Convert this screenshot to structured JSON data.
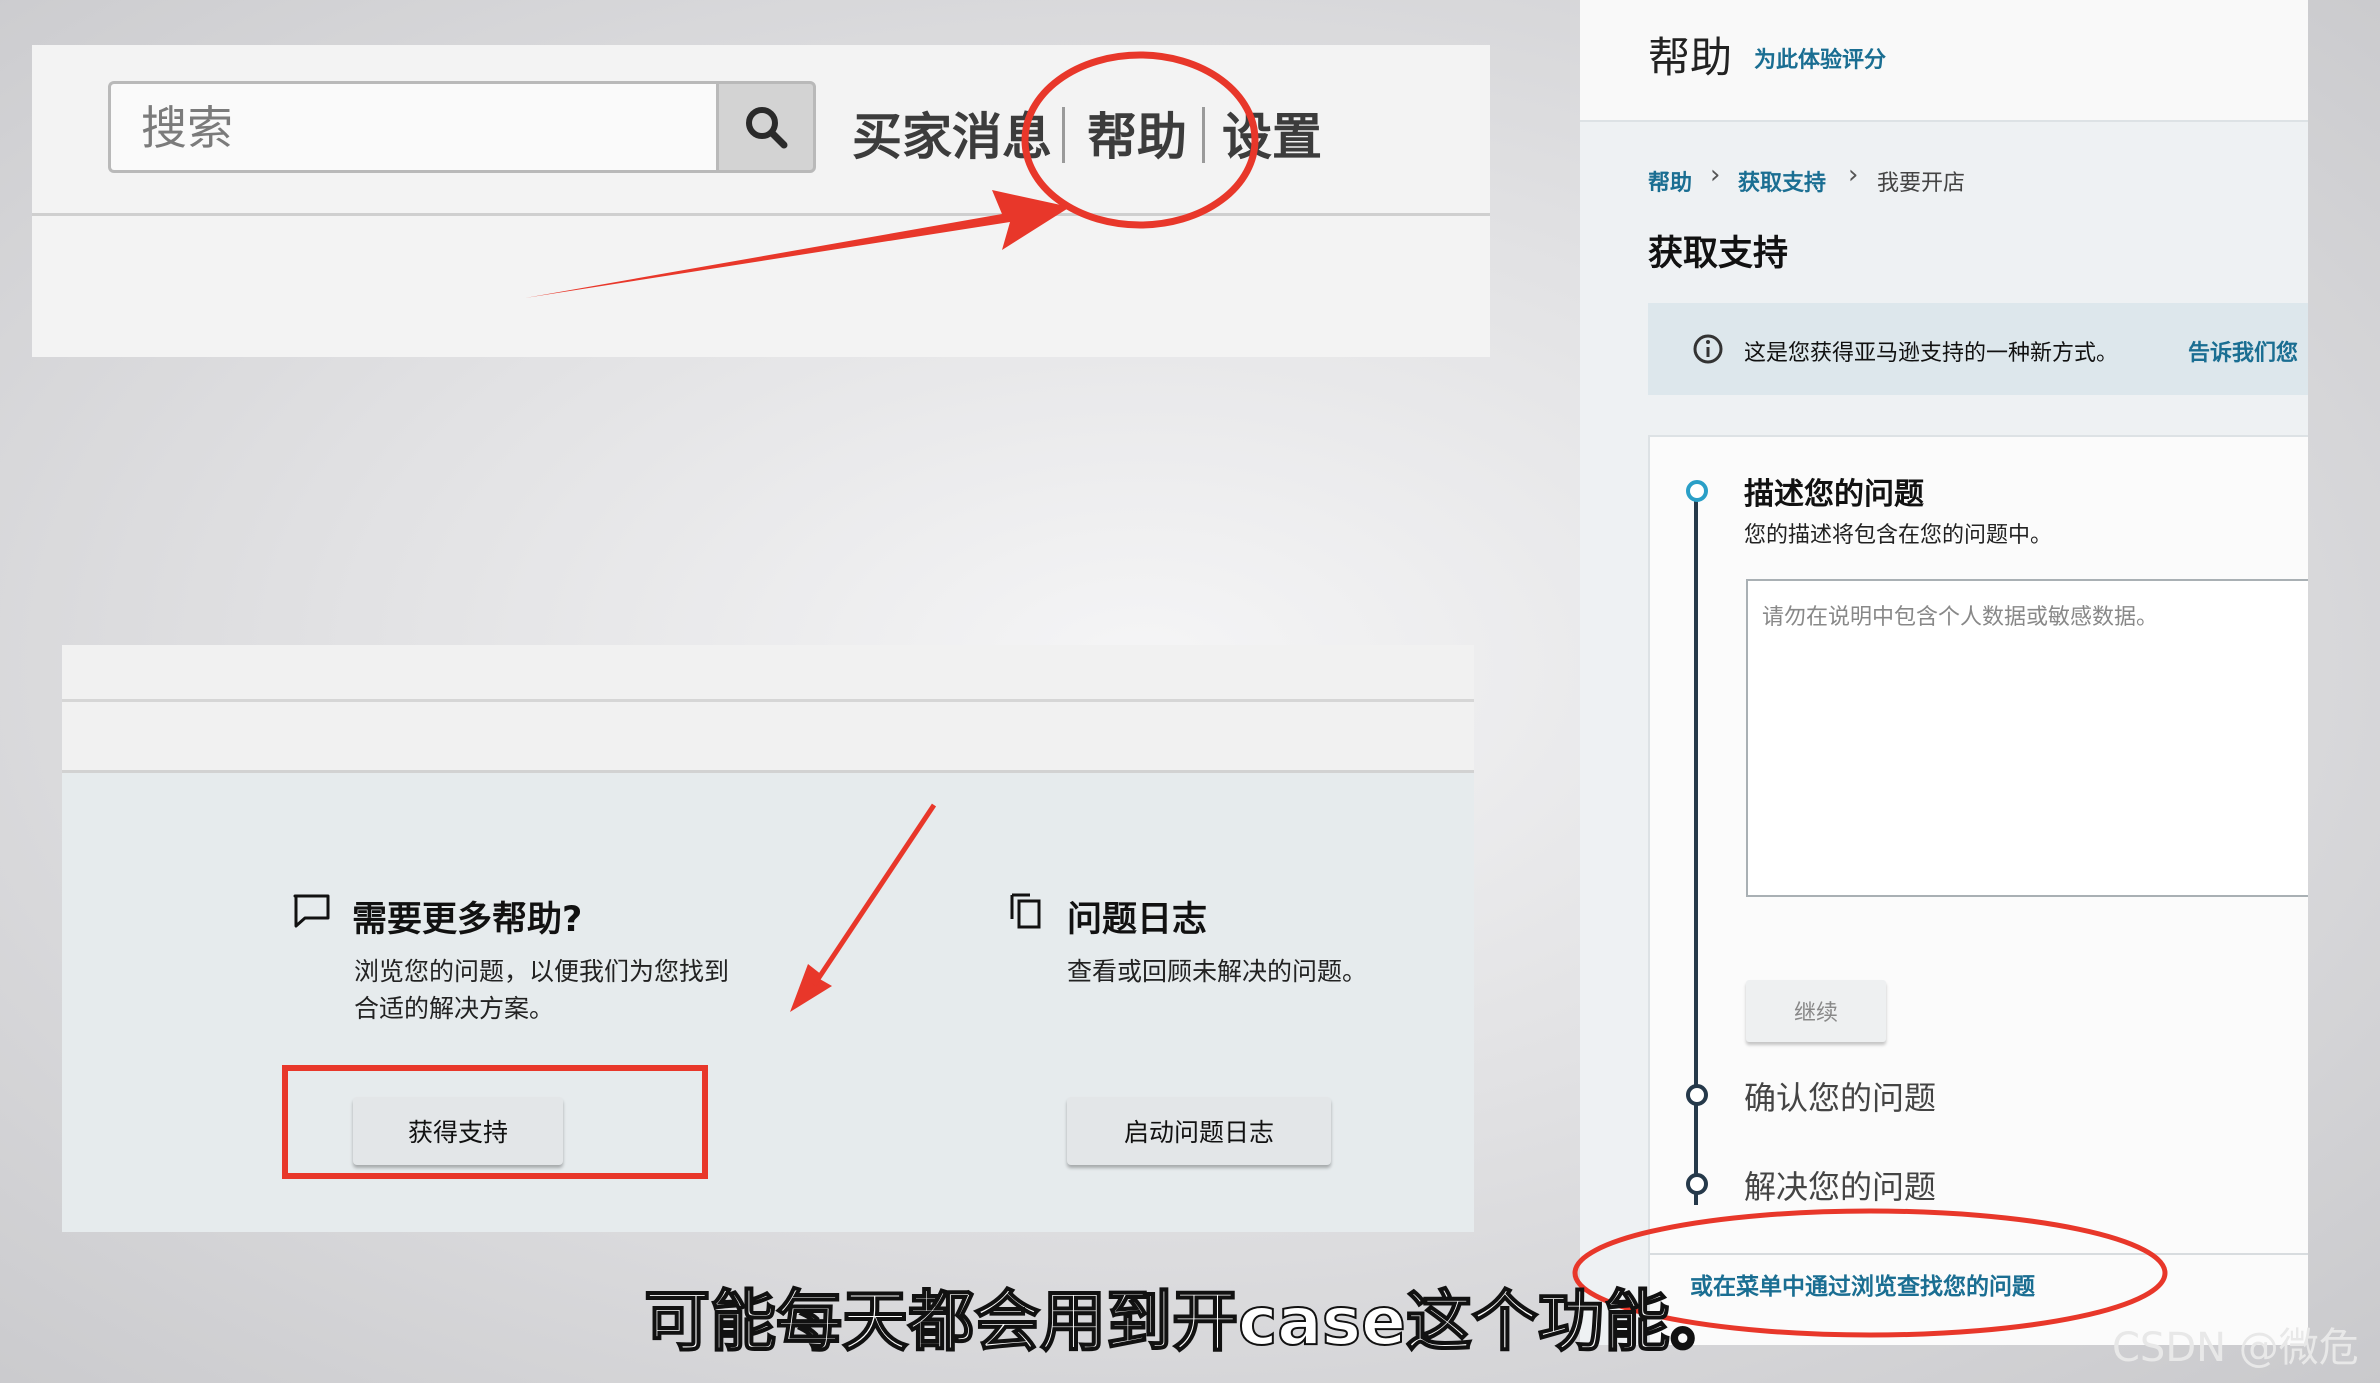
{
  "top_panel": {
    "search_placeholder": "搜索",
    "nav": [
      "买家消息",
      "帮助",
      "设置"
    ]
  },
  "help_panel": {
    "need_help": {
      "title": "需要更多帮助?",
      "desc_line1": "浏览您的问题，以便我们为您找到",
      "desc_line2": "合适的解决方案。",
      "button": "获得支持"
    },
    "case_log": {
      "title": "问题日志",
      "desc": "查看或回顾未解决的问题。",
      "button": "启动问题日志"
    }
  },
  "right_panel": {
    "title": "帮助",
    "rate_link": "为此体验评分",
    "breadcrumb": [
      "帮助",
      "获取支持",
      "我要开店"
    ],
    "page_title": "获取支持",
    "info": {
      "text": "这是您获得亚马逊支持的一种新方式。",
      "link": "告诉我们您"
    },
    "steps": {
      "describe_title": "描述您的问题",
      "describe_desc": "您的描述将包含在您的问题中。",
      "textarea_placeholder": "请勿在说明中包含个人数据或敏感数据。",
      "continue": "继续",
      "confirm": "确认您的问题",
      "resolve": "解决您的问题"
    },
    "browse_link": "或在菜单中通过浏览查找您的问题"
  },
  "subtitle": "可能每天都会用到开case这个功能。",
  "watermark": "CSDN @微危",
  "colors": {
    "accent_link": "#1a6e92",
    "annotation_red": "#e8372a",
    "timeline": "#25394a"
  }
}
